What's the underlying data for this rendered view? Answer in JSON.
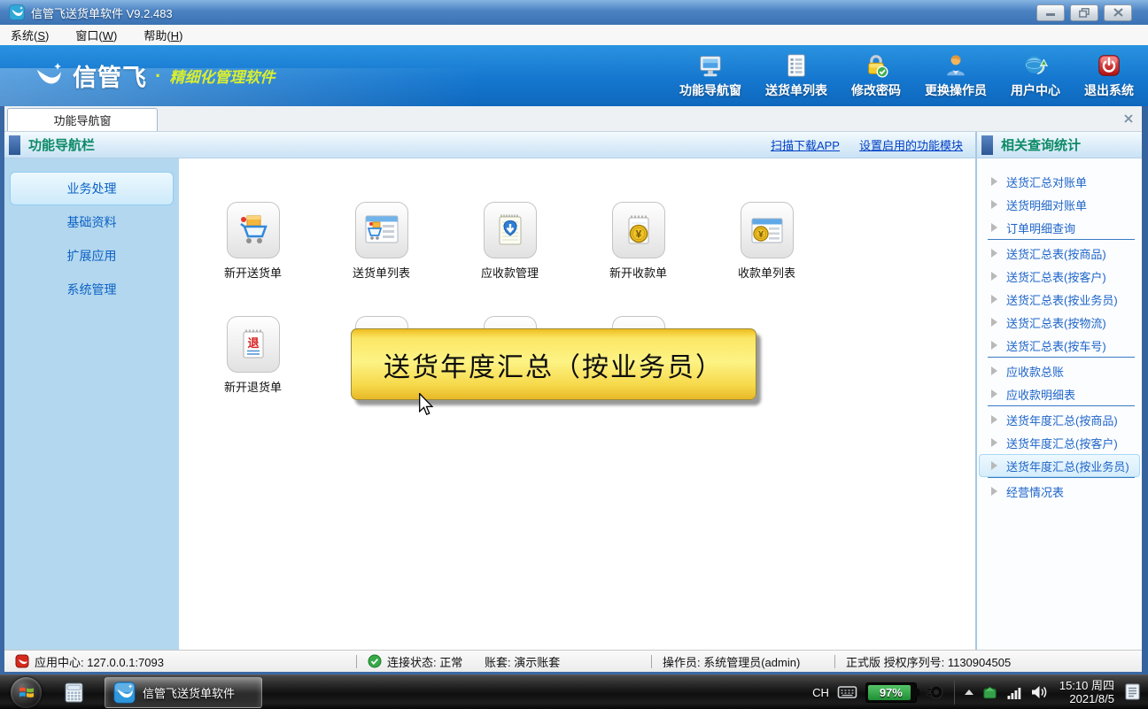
{
  "window": {
    "title": "信管飞送货单软件 V9.2.483"
  },
  "menubar": {
    "items": [
      {
        "pre": "系统(",
        "key": "S",
        "post": ")"
      },
      {
        "pre": "窗口(",
        "key": "W",
        "post": ")"
      },
      {
        "pre": "帮助(",
        "key": "H",
        "post": ")"
      }
    ]
  },
  "toolbar": {
    "brand": {
      "name": "信管飞",
      "sep": "·",
      "tagline": "精细化管理软件"
    },
    "buttons": [
      {
        "icon": "monitor-icon",
        "label": "功能导航窗"
      },
      {
        "icon": "list-icon",
        "label": "送货单列表"
      },
      {
        "icon": "lock-icon",
        "label": "修改密码"
      },
      {
        "icon": "user-icon",
        "label": "更换操作员"
      },
      {
        "icon": "globe-icon",
        "label": "用户中心"
      },
      {
        "icon": "power-icon",
        "label": "退出系统"
      }
    ]
  },
  "tabs": {
    "active": "功能导航窗"
  },
  "nav": {
    "header": "功能导航栏",
    "links": [
      "扫描下载APP",
      "设置启用的功能模块"
    ],
    "sidebar": [
      {
        "label": "业务处理",
        "selected": true
      },
      {
        "label": "基础资料"
      },
      {
        "label": "扩展应用"
      },
      {
        "label": "系统管理"
      }
    ]
  },
  "main": {
    "coin_symbol": "¥",
    "return_char": "退",
    "row1": [
      {
        "icon": "cart-icon",
        "label": "新开送货单"
      },
      {
        "icon": "cart-list-icon",
        "label": "送货单列表"
      },
      {
        "icon": "receivable-icon",
        "label": "应收款管理"
      },
      {
        "icon": "receipt-new-icon",
        "label": "新开收款单"
      },
      {
        "icon": "receipt-list-icon",
        "label": "收款单列表"
      }
    ],
    "row2": [
      {
        "icon": "return-icon",
        "label": "新开退货单"
      },
      {
        "icon": "window-icon"
      },
      {
        "icon": "notepad-icon"
      },
      {
        "icon": "window-icon"
      }
    ],
    "tooltip": "送货年度汇总（按业务员）"
  },
  "stats": {
    "header": "相关查询统计",
    "items": [
      {
        "label": "送货汇总对账单"
      },
      {
        "label": "送货明细对账单"
      },
      {
        "label": "订单明细查询",
        "divider_after": true
      },
      {
        "label": "送货汇总表(按商品)"
      },
      {
        "label": "送货汇总表(按客户)"
      },
      {
        "label": "送货汇总表(按业务员)"
      },
      {
        "label": "送货汇总表(按物流)"
      },
      {
        "label": "送货汇总表(按车号)",
        "divider_after": true
      },
      {
        "label": "应收款总账"
      },
      {
        "label": "应收款明细表",
        "divider_after": true
      },
      {
        "label": "送货年度汇总(按商品)"
      },
      {
        "label": "送货年度汇总(按客户)"
      },
      {
        "label": "送货年度汇总(按业务员)",
        "selected": true,
        "divider_after": true
      },
      {
        "label": "经营情况表"
      }
    ]
  },
  "statusbar": {
    "segments": [
      {
        "icon": "app-logo-icon",
        "text": "应用中心: 127.0.0.1:7093"
      },
      {
        "icon": "check-icon",
        "text": "连接状态: 正常"
      },
      {
        "text": "账套: 演示账套"
      },
      {
        "text": "操作员: 系统管理员(admin)"
      },
      {
        "text": "正式版 授权序列号: 1130904505"
      }
    ]
  },
  "taskbar": {
    "app_label": "信管飞送货单软件",
    "tray": {
      "ime": "CH",
      "battery_percent": "97%",
      "clock_time": "15:10 周四",
      "clock_date": "2021/8/5"
    }
  },
  "colors": {
    "toolbar_blue": "#1577cf",
    "brand_accent": "#d9ee2f",
    "header_green": "#0d8a66",
    "link_blue": "#0040c4",
    "item_blue": "#1e64c8",
    "sidebar_blue": "#b3d7ef",
    "tooltip_gold": "#fdf385",
    "battery_green": "#2fae4a",
    "frame_blue": "#3a68a4",
    "exit_red": "#c81818"
  }
}
